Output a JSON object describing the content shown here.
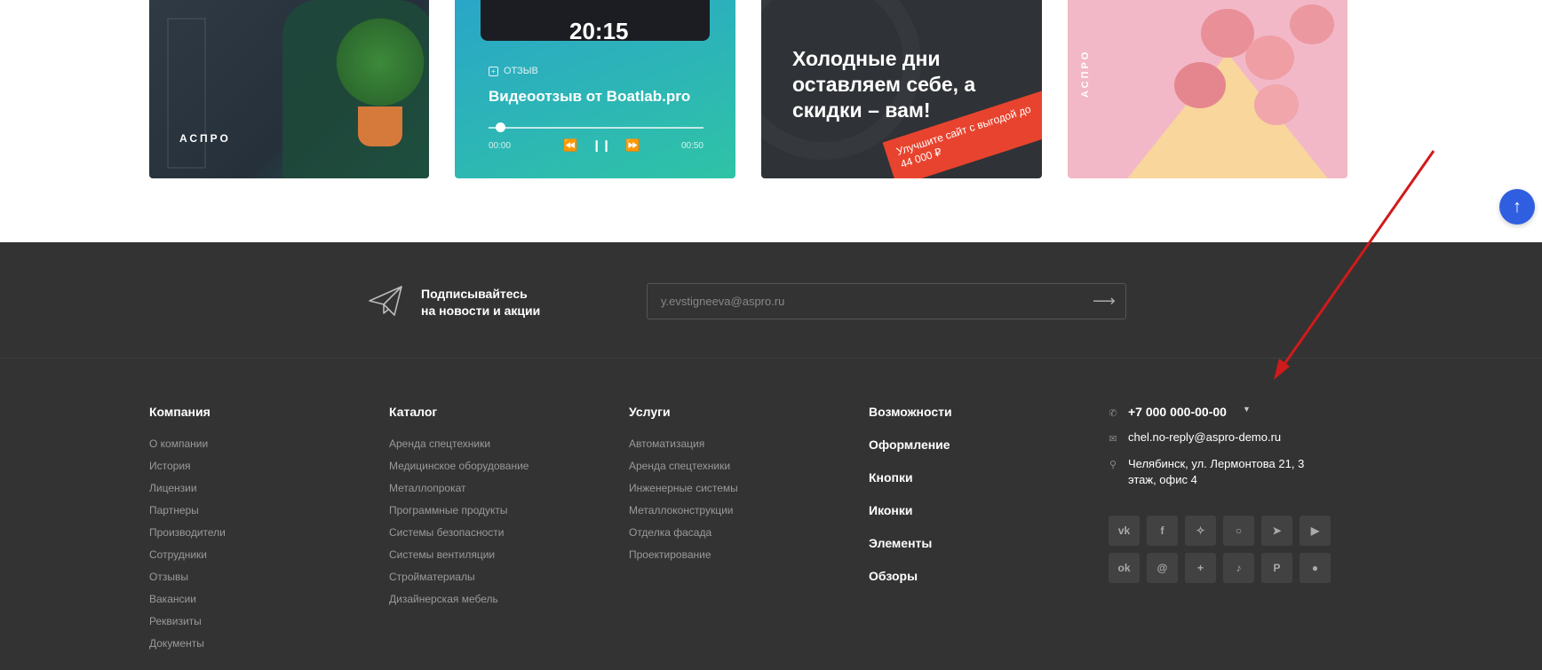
{
  "banners": {
    "card2": {
      "video_label": "20:15",
      "tag": "ОТЗЫВ",
      "title": "Видеоотзыв от Boatlab.pro",
      "time_start": "00:00",
      "time_end": "00:50"
    },
    "card3": {
      "headline": "Холодные дни оставляем себе, а скидки – вам!",
      "promo": "Улучшите сайт с выгодой до 44 000 ₽"
    },
    "card1": {
      "brand": "АСПРО"
    },
    "card4": {
      "brand": "АСПРО"
    }
  },
  "subscribe": {
    "line1": "Подписывайтесь",
    "line2": "на новости и акции",
    "input_value": "y.evstigneeva@aspro.ru"
  },
  "footer": {
    "company": {
      "title": "Компания",
      "items": [
        "О компании",
        "История",
        "Лицензии",
        "Партнеры",
        "Производители",
        "Сотрудники",
        "Отзывы",
        "Вакансии",
        "Реквизиты",
        "Документы"
      ]
    },
    "catalog": {
      "title": "Каталог",
      "items": [
        "Аренда спецтехники",
        "Медицинское оборудование",
        "Металлопрокат",
        "Программные продукты",
        "Системы безопасности",
        "Системы вентиляции",
        "Стройматериалы",
        "Дизайнерская мебель"
      ]
    },
    "services": {
      "title": "Услуги",
      "items": [
        "Автоматизация",
        "Аренда спецтехники",
        "Инженерные системы",
        "Металлоконструкции",
        "Отделка фасада",
        "Проектирование"
      ]
    },
    "features": {
      "items": [
        "Возможности",
        "Оформление",
        "Кнопки",
        "Иконки",
        "Элементы",
        "Обзоры"
      ]
    },
    "contacts": {
      "phone": "+7 000 000-00-00",
      "email": "chel.no-reply@aspro-demo.ru",
      "address_line1": "Челябинск, ул. Лермонтова 21, 3",
      "address_line2": "этаж, офис 4"
    },
    "socials": [
      "vk-icon",
      "facebook-icon",
      "twitter-icon",
      "instagram-icon",
      "telegram-icon",
      "youtube-icon",
      "odnoklassniki-icon",
      "mail-icon",
      "plus-icon",
      "tiktok-icon",
      "pinterest-icon",
      "snapchat-icon"
    ]
  },
  "colors": {
    "footer_bg": "#333333",
    "accent_blue": "#2f5fe0",
    "annotation_arrow": "#d11a1a",
    "promo_red": "#e8432e"
  }
}
